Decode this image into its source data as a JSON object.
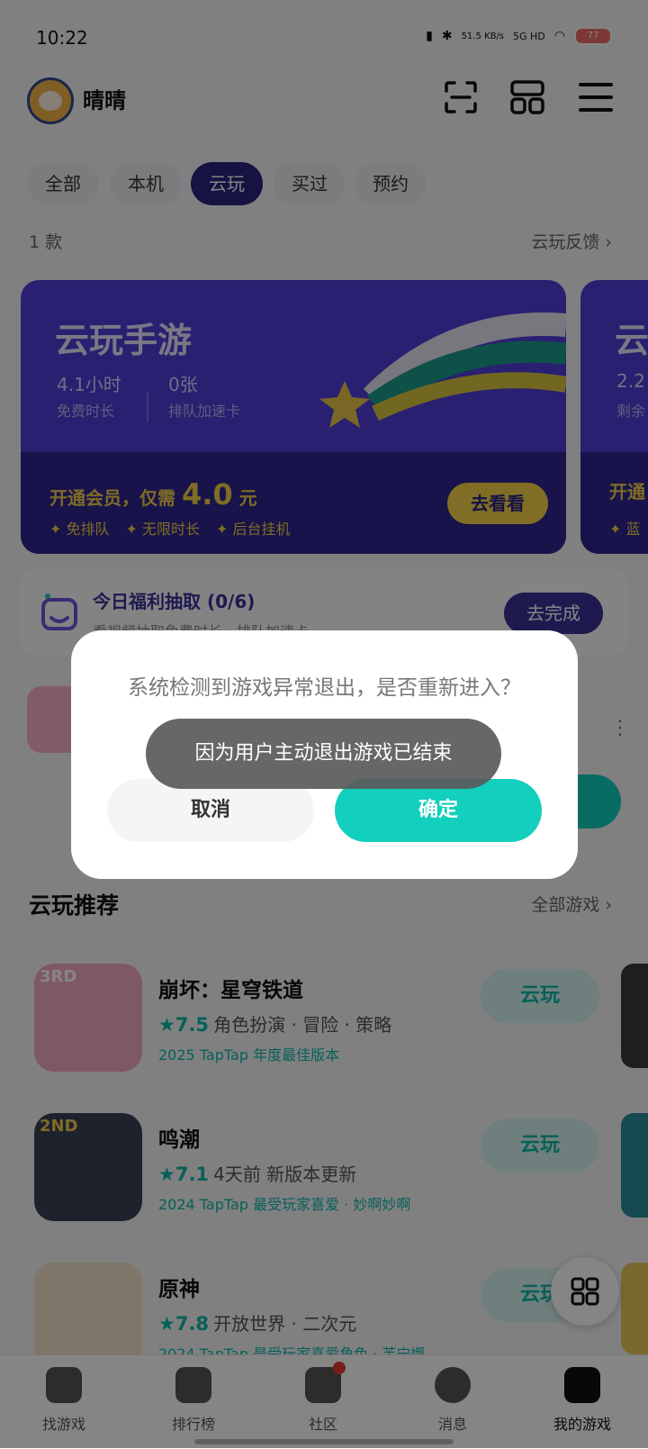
{
  "status_bar": {
    "time": "10:22",
    "speed": "51.5 KB/s",
    "network": "5G HD",
    "battery": "77"
  },
  "header": {
    "username": "晴晴"
  },
  "filters": {
    "tabs": [
      "全部",
      "本机",
      "云玩",
      "买过",
      "预约"
    ],
    "active": "云玩"
  },
  "list_meta": {
    "count": "1 款",
    "feedback": "云玩反馈 ›"
  },
  "promo_card": {
    "title": "云玩手游",
    "stat1_value": "4.1小时",
    "stat1_label": "免费时长",
    "stat2_value": "0张",
    "stat2_label": "排队加速卡",
    "offer_prefix": "开通会员，仅需",
    "offer_price": "4.0",
    "offer_unit": "元",
    "perks": [
      "免排队",
      "无限时长",
      "后台挂机"
    ],
    "button": "去看看"
  },
  "promo_card_2": {
    "title": "云",
    "stat_value": "2.2",
    "stat_label": "剩余",
    "offer": "开通",
    "perk": "蓝"
  },
  "daily_task": {
    "title": "今日福利抽取 (0/6)",
    "subtitle": "看视频抽取免费时长、排队加速卡",
    "button": "去完成"
  },
  "dialog": {
    "message": "系统检测到游戏异常退出，是否重新进入？",
    "cancel": "取消",
    "confirm": "确定"
  },
  "toast": {
    "text": "因为用户主动退出游戏已结束"
  },
  "recommend": {
    "title": "云玩推荐",
    "more": "全部游戏 ›",
    "games": [
      {
        "name": "崩坏：星穹铁道",
        "rating": "★7.5",
        "tags": "角色扮演 · 冒险 · 策略",
        "award": "2025 TapTap 年度最佳版本",
        "button": "云玩",
        "icon_color": "#f4a9c4"
      },
      {
        "name": "鸣潮",
        "rating": "★7.1",
        "tags": "4天前 新版本更新",
        "award": "2024 TapTap 最受玩家喜爱 · 妙啊妙啊",
        "button": "云玩",
        "icon_color": "#3b4256"
      },
      {
        "name": "原神",
        "rating": "★7.8",
        "tags": "开放世界 · 二次元",
        "award": "2024 TapTap 最受玩家喜爱角色 · 芙宁娜",
        "button": "云玩",
        "icon_color": "#f1e3c7"
      }
    ]
  },
  "bottom_nav": {
    "items": [
      "找游戏",
      "排行榜",
      "社区",
      "消息",
      "我的游戏"
    ],
    "active": "我的游戏"
  }
}
